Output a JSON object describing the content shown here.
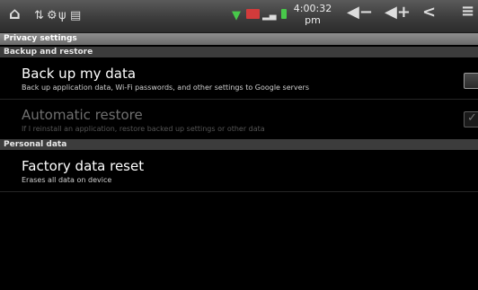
{
  "status_bar": {
    "time_line1": "4:00:32",
    "time_line2": "pm",
    "icons": [
      "home-icon",
      "usb-icon",
      "sync-icon",
      "usb-debug-icon",
      "sd-card-icon",
      "wifi-icon",
      "no-signal-icon",
      "signal-bars-icon",
      "battery-icon",
      "volume-down-icon",
      "volume-up-icon",
      "back-icon",
      "menu-icon"
    ]
  },
  "header": {
    "title": "Privacy settings"
  },
  "sections": [
    {
      "label": "Backup and restore",
      "items": [
        {
          "title": "Back up my data",
          "subtitle": "Back up application data, Wi-Fi passwords, and other settings to Google servers",
          "checked": false,
          "enabled": true
        },
        {
          "title": "Automatic restore",
          "subtitle": "If I reinstall an application, restore backed up settings or other data",
          "checked": true,
          "enabled": false
        }
      ]
    },
    {
      "label": "Personal data",
      "items": [
        {
          "title": "Factory data reset",
          "subtitle": "Erases all data on device"
        }
      ]
    }
  ],
  "colors": {
    "accent_green": "#48c84a",
    "alert_red": "#d23b3b"
  }
}
